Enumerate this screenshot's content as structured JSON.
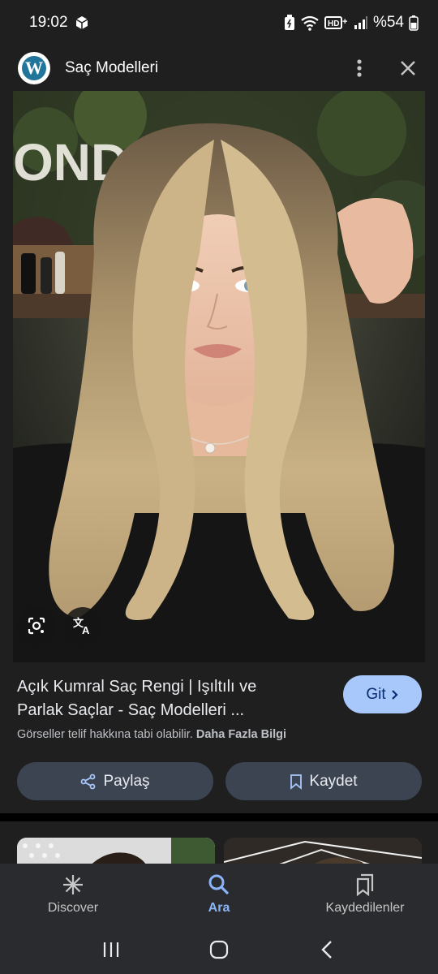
{
  "status": {
    "time": "19:02",
    "battery": "%54",
    "icons": [
      "box-icon",
      "battery-saver-icon",
      "wifi-icon",
      "volte-icon",
      "signal-icon",
      "battery-icon"
    ]
  },
  "header": {
    "title": "Saç Modelleri",
    "logo_letter": "W",
    "icons": [
      "wordpress-logo",
      "more-vert-icon",
      "close-icon"
    ]
  },
  "image": {
    "overlay_icons": [
      "google-lens-icon",
      "translate-icon"
    ]
  },
  "result": {
    "title_line1": "Açık Kumral Saç Rengi | Işıltılı ve",
    "title_line2": "Parlak Saçlar - Saç Modelleri ...",
    "visit_label": "Git",
    "copyright": "Görseller telif hakkına tabi olabilir.",
    "more_info": "Daha Fazla Bilgi",
    "share_label": "Paylaş",
    "save_label": "Kaydet"
  },
  "bottom_nav": {
    "items": [
      {
        "label": "Discover",
        "icon": "asterisk-icon",
        "active": false
      },
      {
        "label": "Ara",
        "icon": "search-icon",
        "active": true
      },
      {
        "label": "Kaydedilenler",
        "icon": "collections-icon",
        "active": false
      }
    ]
  },
  "system_nav": {
    "icons": [
      "recent-apps-icon",
      "home-icon",
      "back-icon"
    ]
  },
  "colors": {
    "background": "#1f1f1f",
    "accent_button": "#a8c7fa",
    "secondary_button": "#3c4452",
    "active_nav": "#8ab4f8"
  }
}
